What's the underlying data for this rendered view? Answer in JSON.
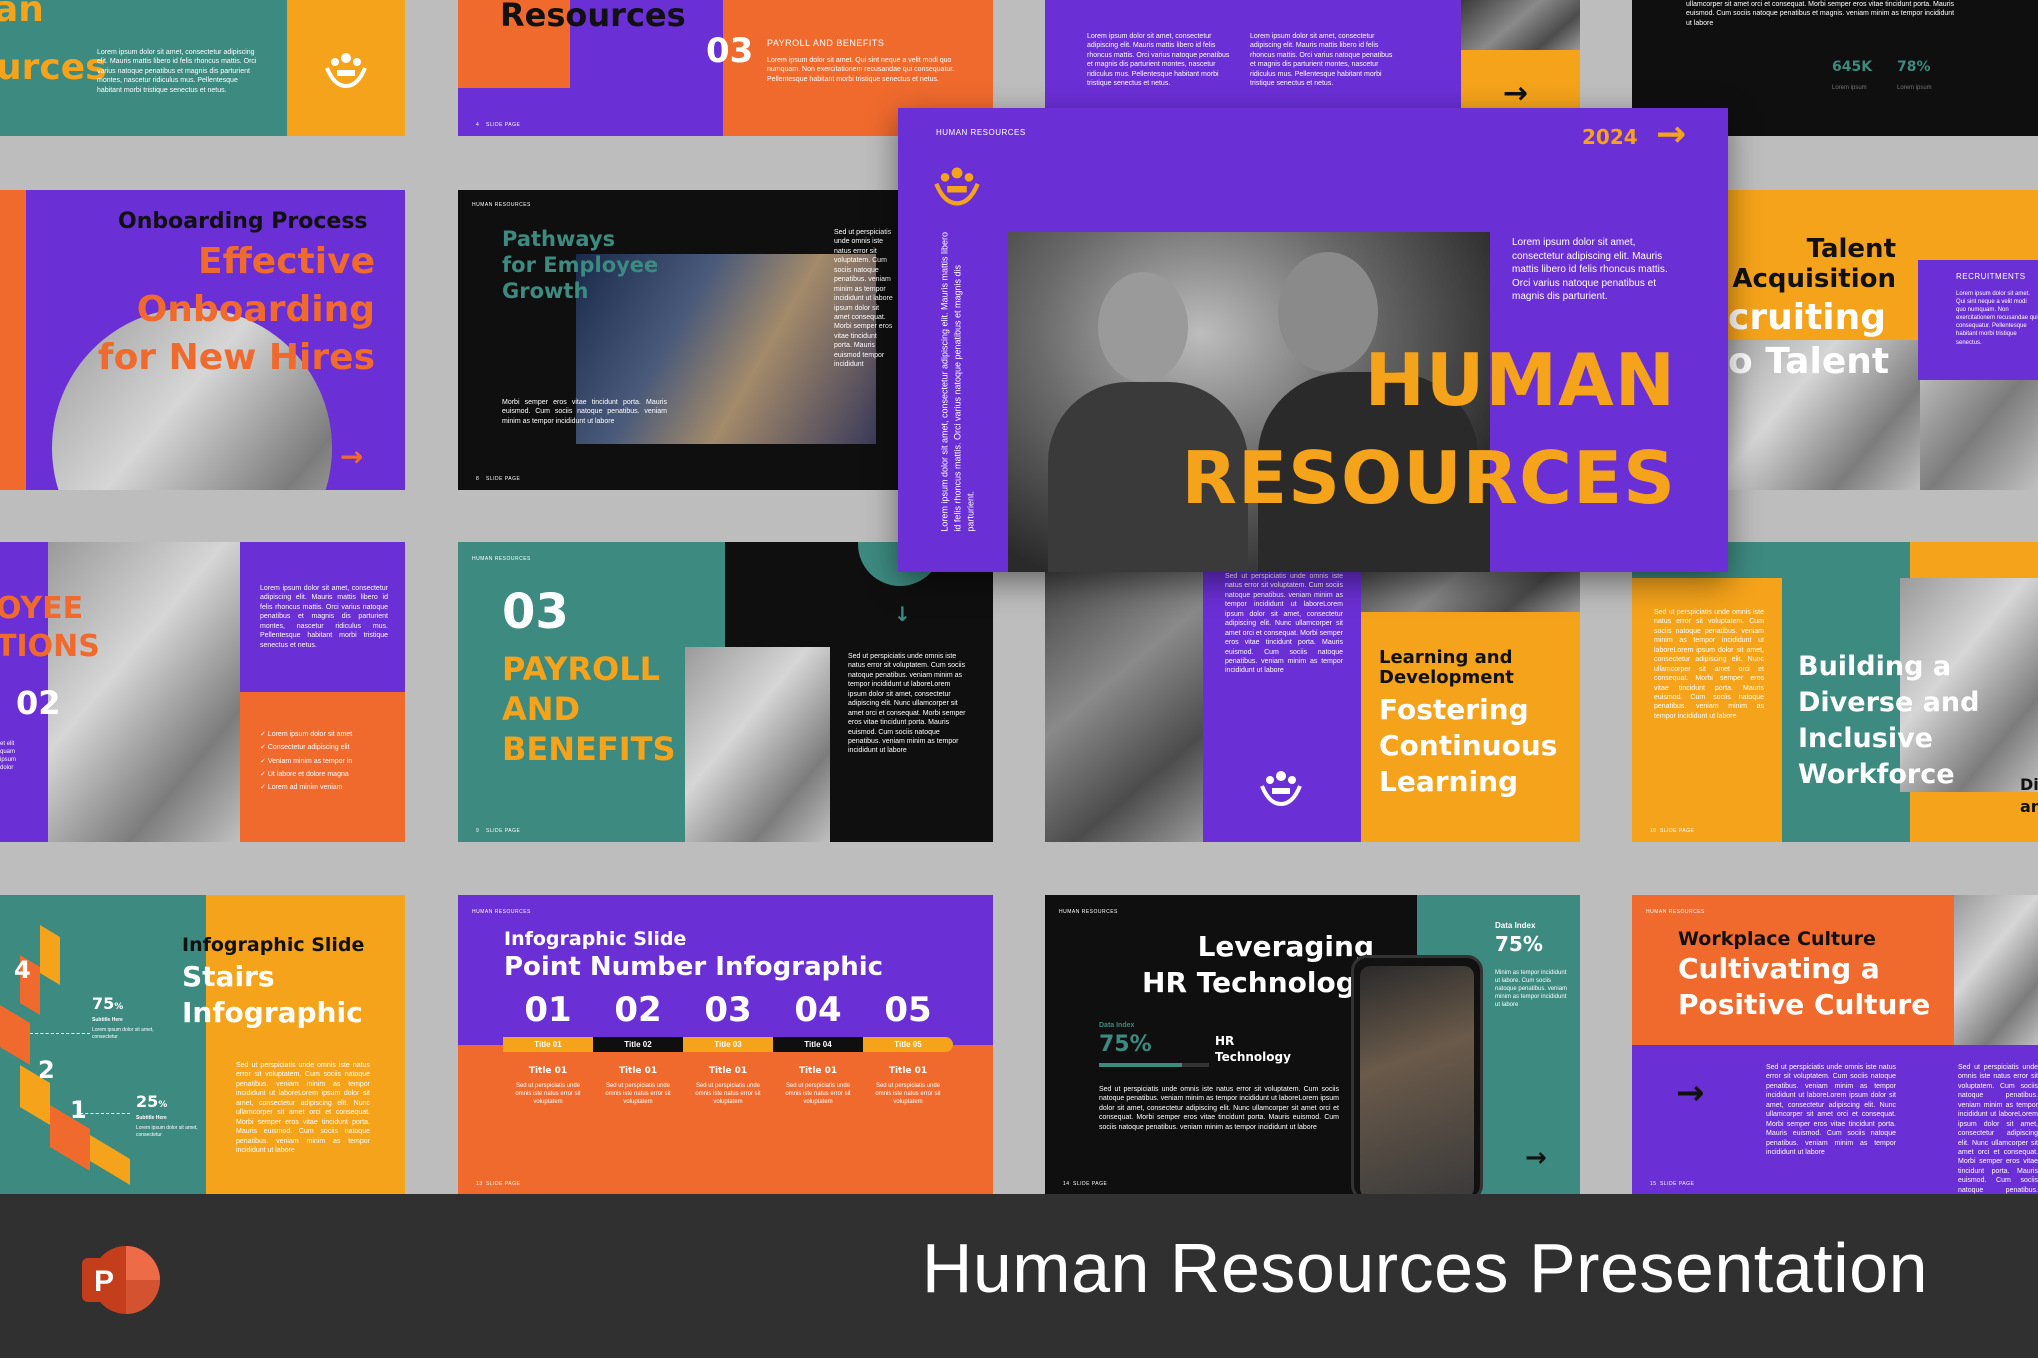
{
  "colors": {
    "purple": "#6b2fd6",
    "orange": "#f06a2d",
    "amber": "#f5a31a",
    "teal": "#3d8a80",
    "black": "#0f0f0f",
    "gray_bg": "#bdbdbd",
    "footer_bg": "#303030"
  },
  "footer": {
    "title": "Human Resources Presentation",
    "icon": "powerpoint-icon",
    "icon_letter": "P"
  },
  "common": {
    "brand": "HUMAN RESOURCES",
    "slide_page": "SLIDE PAGE",
    "logo_icon": "hands-people-icon"
  },
  "cover": {
    "brand": "HUMAN RESOURCES",
    "year": "2024",
    "title_line1": "HUMAN",
    "title_line2": "RESOURCES",
    "body": "Lorem ipsum dolor sit amet, consectetur adipiscing elit. Mauris mattis libero id felis rhoncus mattis. Orci varius natoque penatibus et magnis dis parturient.",
    "vertical_text": "Lorem ipsum dolor sit amet, consectetur adipiscing elit. Mauris mattis libero id felis rhoncus mattis. Orci varius natoque penatibus et magnis dis parturient."
  },
  "slides": {
    "r1c1": {
      "title_a": "an",
      "title_b": "urces",
      "body": "Lorem ipsum dolor sit amet, consectetur adipiscing elit. Mauris mattis libero id felis rhoncus mattis. Orci varius natoque penatibus et magnis dis parturient montes, nascetur ridiculus mus. Pellentesque habitant morbi tristique senectus et netus."
    },
    "r1c2": {
      "title": "Resources",
      "number": "03",
      "label": "PAYROLL AND BENEFITS",
      "body": "Lorem ipsum dolor sit amet. Qui sint neque a velit modi quo numquam. Non exercitationem recusandae qui consequatur. Pellentesque habitant morbi tristique senectus et netus.",
      "page": "4"
    },
    "r1c3": {
      "body1": "Lorem ipsum dolor sit amet, consectetur adipiscing elit. Mauris mattis libero id felis rhoncus mattis. Orci varius natoque penatibus et magnis dis parturient montes, nascetur ridiculus mus. Pellentesque habitant morbi tristique senectus et netus.",
      "body2": "Lorem ipsum dolor sit amet, consectetur adipiscing elit. Mauris mattis libero id felis rhoncus mattis. Orci varius natoque penatibus et magnis dis parturient montes, nascetur ridiculus mus. Pellentesque habitant morbi tristique senectus et netus."
    },
    "r1c4": {
      "body": "ullamcorper sit amet orci et consequat. Morbi semper eros vitae tincidunt porta. Mauris euismod. Cum sociis natoque penatibus et magnis. veniam minim as tempor incididunt ut labore",
      "stat1": "645K",
      "stat1_label": "Lorem ipsum",
      "stat2": "78%",
      "stat2_label": "Lorem ipsum"
    },
    "r2c1": {
      "subtitle": "Onboarding Process",
      "title_line1": "Effective",
      "title_line2": "Onboarding",
      "title_line3": "for New Hires"
    },
    "r2c2": {
      "title_line1": "Pathways",
      "title_line2": "for Employee",
      "title_line3": "Growth",
      "body": "Morbi semper eros vitae tincidunt porta. Mauris euismod. Cum sociis natoque penatibus. veniam minim as tempor incididunt ut labore",
      "side": "Sed ut perspiciatis unde omnis iste natus error sit voluptatem. Cum sociis natoque penatibus. veniam minim as tempor incididunt ut labore ipsum dolor sit amet consequat. Morbi semper eros vitae tincidunt porta. Mauris euismod tempor incididunt",
      "page": "8"
    },
    "r2c4": {
      "title_line1": "Talent",
      "title_line2": "Acquisition",
      "title_line3": "cruiting",
      "title_line4": "o Talent",
      "label": "RECRUITMENTS",
      "body": "Lorem ipsum dolor sit amet. Qui sint neque a velit modi quo numquam. Non exercitationem recusandae qui consequatur. Pellentesque habitant morbi tristique senectus."
    },
    "r3c1": {
      "title_a": "OYEE",
      "title_b": "TIONS",
      "number": "02",
      "body": "Lorem ipsum dolor sit amet, consectetur adipiscing elit. Mauris mattis libero id felis rhoncus mattis. Orci varius natoque penatibus et magnis dis parturient montes, nascetur ridiculus mus. Pellentesque habitant morbi tristique senectus et netus.",
      "bullets": [
        "Lorem ipsum dolor sit amet",
        "Consectetur adipiscing elit",
        "Veniam minim as tempor in",
        "Ut labore et dolore magna",
        "Lorem ad minim veniam"
      ],
      "side": "et elit quam ipsum dolor"
    },
    "r3c2": {
      "number": "03",
      "title_line1": "PAYROLL",
      "title_line2": "AND",
      "title_line3": "BENEFITS",
      "body": "Sed ut perspiciatis unde omnis iste natus error sit voluptatem. Cum sociis natoque penatibus. veniam minim as tempor incididunt ut laboreLorem ipsum dolor sit amet, consectetur adipiscing elit. Nunc ullamcorper sit amet orci et consequat. Morbi semper eros vitae tincidunt porta. Mauris euismod. Cum sociis natoque penatibus. veniam minim as tempor incididunt ut labore",
      "page": "9",
      "arrow": "↓"
    },
    "r3c3": {
      "body": "Sed ut perspiciatis unde omnis iste natus error sit voluptatem. Cum sociis natoque penatibus. veniam minim as tempor incididunt ut laboreLorem ipsum dolor sit amet, consectetur adipiscing elit. Nunc ullamcorper sit amet orci et consequat. Morbi semper eros vitae tincidunt porta. Mauris euismod. Cum sociis natoque penatibus. veniam minim as tempor incididunt ut labore",
      "subtitle": "Learning and Development",
      "title_line1": "Fostering",
      "title_line2": "Continuous",
      "title_line3": "Learning"
    },
    "r3c4": {
      "body": "Sed ut perspiciatis unde omnis iste natus error sit voluptatem. Cum sociis natoque penatibus. veniam minim as tempor incididunt ut laboreLorem ipsum dolor sit amet, consectetur adipiscing elit. Nunc ullamcorper sit amet orci et consequat. Morbi semper eros vitae tincidunt porta. Mauris euismod. Cum sociis natoque penatibus. veniam minim as tempor incididunt ut labore",
      "title_line1": "Building a",
      "title_line2": "Diverse and",
      "title_line3": "Inclusive",
      "title_line4": "Workforce",
      "edge_a": "Di",
      "edge_b": "an",
      "page": "10"
    },
    "r4c1": {
      "subtitle": "Infographic Slide",
      "title_line1": "Stairs",
      "title_line2": "Infographic",
      "stat1": "75",
      "stat1_unit": "%",
      "stat1_label": "Subtitle Here",
      "stat1_body": "Lorem ipsum dolor sit amet, consectetur",
      "stat2": "25",
      "stat2_unit": "%",
      "stat2_label": "Subtitle Here",
      "stat2_body": "Lorem ipsum dolor sit amet, consectetur",
      "steps": [
        "4",
        "2",
        "1"
      ],
      "body": "Sed ut perspiciatis unde omnis iste natus error sit voluptatem. Cum sociis natoque penatibus. veniam minim as tempor incididunt ut laboreLorem ipsum dolor sit amet, consectetur adipiscing elit. Nunc ullamcorper sit amet orci et consequat. Morbi semper eros vitae tincidunt porta. Mauris euismod. Cum sociis natoque penatibus. veniam minim as tempor incididunt ut labore"
    },
    "r4c2": {
      "subtitle": "Infographic Slide",
      "title": "Point Number Infographic",
      "numbers": [
        "01",
        "02",
        "03",
        "04",
        "05"
      ],
      "bar_labels": [
        "Title 01",
        "Title 02",
        "Title 03",
        "Title 04",
        "Title 05"
      ],
      "col_titles": [
        "Title 01",
        "Title 01",
        "Title 01",
        "Title 01",
        "Title 01"
      ],
      "col_body": "Sed ut perspiciatis unde omnis iste natus error sit voluptatem",
      "page": "13"
    },
    "r4c3": {
      "title_line1": "Leveraging",
      "title_line2": "HR Technology",
      "data_label": "Data Index",
      "data_value": "75%",
      "hr_label_line1": "HR",
      "hr_label_line2": "Technology",
      "side_label": "Data Index",
      "side_value": "75%",
      "side_body": "Minim as tempor incididunt ut labore. Cum sociis natoque penatibus. veniam minim as tempor incididunt ut labore",
      "body": "Sed ut perspiciatis unde omnis iste natus error sit voluptatem. Cum sociis natoque penatibus. veniam minim as tempor incididunt ut laboreLorem ipsum dolor sit amet, consectetur adipiscing elit. Nunc ullamcorper sit amet orci et consequat. Morbi semper eros vitae tincidunt porta. Mauris euismod. Cum sociis natoque penatibus. veniam minim as tempor incididunt ut labore",
      "page": "14"
    },
    "r4c4": {
      "subtitle": "Workplace Culture",
      "title_line1": "Cultivating a",
      "title_line2": "Positive Culture",
      "body1": "Sed ut perspiciatis unde omnis iste natus error sit voluptatem. Cum sociis natoque penatibus. veniam minim as tempor incididunt ut laboreLorem ipsum dolor sit amet, consectetur adipiscing elit. Nunc ullamcorper sit amet orci et consequat. Morbi semper eros vitae tincidunt porta. Mauris euismod. Cum sociis natoque penatibus. veniam minim as tempor incididunt ut labore",
      "body2": "Sed ut perspiciatis unde omnis iste natus error sit voluptatem. Cum sociis natoque penatibus. veniam minim as tempor incididunt ut laboreLorem ipsum dolor sit amet, consectetur adipiscing elit. Nunc ullamcorper sit amet orci et consequat. Morbi semper eros vitae tincidunt porta. Mauris euismod. Cum sociis natoque penatibus. veniam minim as tempor incididunt ut labore",
      "page": "15"
    }
  }
}
